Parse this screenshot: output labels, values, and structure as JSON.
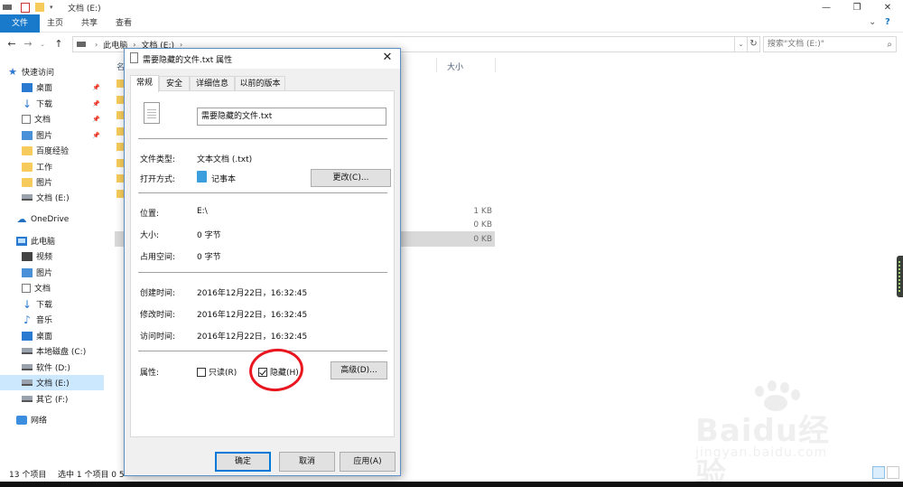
{
  "window": {
    "title": "文档 (E:)",
    "tabs": [
      "文件",
      "主页",
      "共享",
      "查看"
    ],
    "address": {
      "crumbs": [
        "此电脑",
        "文档 (E:)"
      ]
    },
    "search_placeholder": "搜索\"文档 (E:)\""
  },
  "nav": {
    "quick_access": "快速访问",
    "items": [
      {
        "label": "桌面",
        "pinned": true
      },
      {
        "label": "下载",
        "pinned": true
      },
      {
        "label": "文档",
        "pinned": true
      },
      {
        "label": "图片",
        "pinned": true
      },
      {
        "label": "百度经验"
      },
      {
        "label": "工作"
      },
      {
        "label": "图片"
      },
      {
        "label": "文档 (E:)"
      }
    ],
    "onedrive": "OneDrive",
    "this_pc": "此电脑",
    "pc_items": [
      "视频",
      "图片",
      "文档",
      "下载",
      "音乐",
      "桌面",
      "本地磁盘 (C:)",
      "软件 (D:)",
      "文档 (E:)",
      "其它 (F:)"
    ],
    "network": "网络"
  },
  "filelist": {
    "col_name_partial": "名",
    "col_size": "大小",
    "sizes": [
      "1 KB",
      "0 KB",
      "0 KB"
    ]
  },
  "status": {
    "count": "13 个项目",
    "selected": "选中 1 个项目 0 5"
  },
  "dialog": {
    "title": "需要隐藏的文件.txt 属性",
    "tabs": [
      "常规",
      "安全",
      "详细信息",
      "以前的版本"
    ],
    "filename": "需要隐藏的文件.txt",
    "type_label": "文件类型:",
    "type_value": "文本文档 (.txt)",
    "open_label": "打开方式:",
    "open_value": "记事本",
    "change_btn": "更改(C)...",
    "location_label": "位置:",
    "location_value": "E:\\",
    "size_label": "大小:",
    "size_value": "0 字节",
    "disk_label": "占用空间:",
    "disk_value": "0 字节",
    "created_label": "创建时间:",
    "created_value": "2016年12月22日，16:32:45",
    "modified_label": "修改时间:",
    "modified_value": "2016年12月22日，16:32:45",
    "accessed_label": "访问时间:",
    "accessed_value": "2016年12月22日，16:32:45",
    "attr_label": "属性:",
    "readonly": {
      "label": "只读(R)",
      "checked": false
    },
    "hidden": {
      "label": "隐藏(H)",
      "checked": true
    },
    "advanced_btn": "高级(D)...",
    "ok": "确定",
    "cancel": "取消",
    "apply": "应用(A)"
  },
  "watermark": {
    "brand": "Baidu经验",
    "url": "jingyan.baidu.com"
  },
  "colors": {
    "accent": "#1979ca",
    "selection": "#cce8ff",
    "annotation": "#e8161f"
  }
}
